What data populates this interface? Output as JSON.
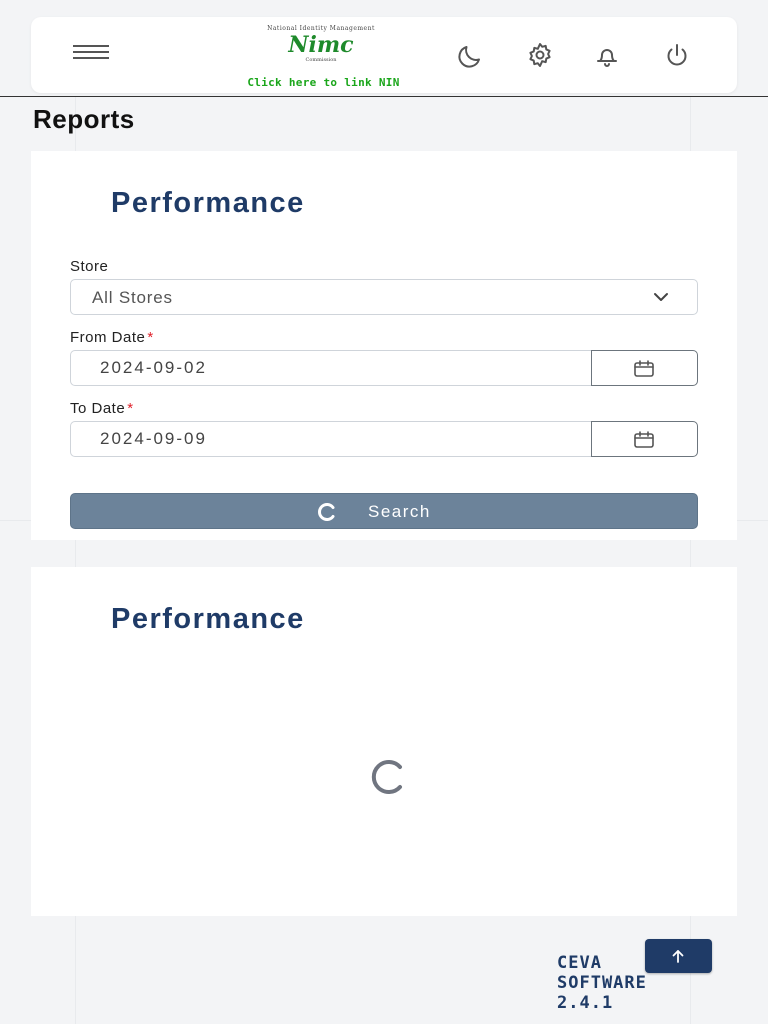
{
  "header": {
    "logo_arc_text": "National Identity Management",
    "logo_text": "Nimc",
    "logo_sub_text": "Commission",
    "link_nin": "Click here to link NIN",
    "icons": [
      "menu-icon",
      "moon-icon",
      "gear-icon",
      "bell-icon",
      "power-icon"
    ]
  },
  "page": {
    "title": "Reports"
  },
  "filter_card": {
    "title": "Performance",
    "store_label": "Store",
    "store_value": "All Stores",
    "from_label": "From Date",
    "from_value": "2024-09-02",
    "to_label": "To Date",
    "to_value": "2024-09-09",
    "required_mark": "*",
    "search_label": "Search"
  },
  "result_card": {
    "title": "Performance"
  },
  "footer": {
    "line1": "CEVA",
    "line2": "SOFTWARE",
    "line3": "2.4.1"
  },
  "colors": {
    "accent": "#1f3b67",
    "search_button": "#6c839a",
    "nimc_green": "#1e8a2b",
    "required": "#e0202a"
  }
}
